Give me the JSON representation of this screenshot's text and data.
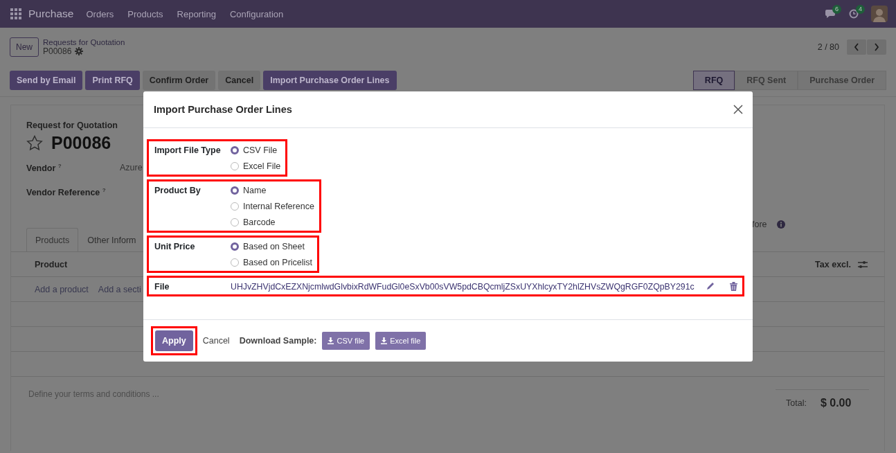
{
  "navbar": {
    "app_name": "Purchase",
    "menu": [
      "Orders",
      "Products",
      "Reporting",
      "Configuration"
    ],
    "messages_count": "6",
    "activities_count": "4"
  },
  "control_panel": {
    "new_button": "New",
    "breadcrumb_parent": "Requests for Quotation",
    "record": "P00086",
    "pager": "2 / 80"
  },
  "action_buttons": [
    {
      "label": "Send by Email",
      "kind": "primary"
    },
    {
      "label": "Print RFQ",
      "kind": "primary"
    },
    {
      "label": "Confirm Order",
      "kind": "secondary"
    },
    {
      "label": "Cancel",
      "kind": "secondary"
    },
    {
      "label": "Import Purchase Order Lines",
      "kind": "primary"
    }
  ],
  "status_bar": [
    {
      "label": "RFQ",
      "selected": true
    },
    {
      "label": "RFQ Sent",
      "selected": false
    },
    {
      "label": "Purchase Order",
      "selected": false
    }
  ],
  "form": {
    "title_label": "Request for Quotation",
    "record_name": "P00086",
    "starred": false,
    "fields": [
      {
        "label": "Vendor",
        "help": "?",
        "value": "Azure"
      },
      {
        "label": "Vendor Reference",
        "help": "?"
      }
    ],
    "right_field_fragment": "fore",
    "tabs": [
      {
        "label": "Products",
        "selected": true
      },
      {
        "label": "Other Inform",
        "selected": false
      }
    ],
    "columns": [
      "Product",
      "Tax excl."
    ],
    "add_links": [
      "Add a product",
      "Add a secti"
    ],
    "terms_placeholder": "Define your terms and conditions ...",
    "total_label": "Total:",
    "total_value": "$ 0.00"
  },
  "dialog": {
    "title": "Import Purchase Order Lines",
    "groups": [
      {
        "label": "Import File Type",
        "highlighted": true,
        "options": [
          {
            "label": "CSV File",
            "selected": true
          },
          {
            "label": "Excel File",
            "selected": false
          }
        ]
      },
      {
        "label": "Product By",
        "highlighted": true,
        "options": [
          {
            "label": "Name",
            "selected": true
          },
          {
            "label": "Internal Reference",
            "selected": false
          },
          {
            "label": "Barcode",
            "selected": false
          }
        ]
      },
      {
        "label": "Unit Price",
        "highlighted": true,
        "options": [
          {
            "label": "Based on Sheet",
            "selected": true
          },
          {
            "label": "Based on Pricelist",
            "selected": false
          }
        ]
      }
    ],
    "file": {
      "label": "File",
      "value": "UHJvZHVjdCxEZXNjcmlwdGlvbixRdWFudGl0eSxVb00sVW5pdCBQcmljZSxUYXhlcyxTY2hlZHVsZWQgRGF0ZQpBY291c",
      "highlighted": true
    },
    "apply": {
      "label": "Apply",
      "highlighted": true
    },
    "cancel": "Cancel",
    "download_label": "Download Sample:",
    "sample_buttons": [
      "CSV file",
      "Excel file"
    ]
  }
}
